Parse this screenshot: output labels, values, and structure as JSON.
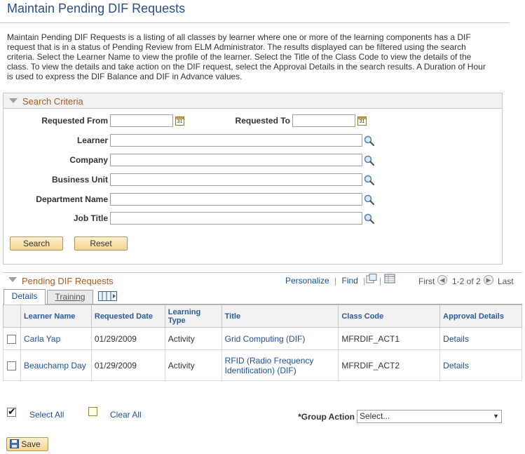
{
  "page": {
    "title": "Maintain Pending DIF Requests",
    "description": "Maintain Pending DIF Requests is a listing of all classes by learner where one or more of the learning components has a DIF request that is in a status of Pending Review from ELM Administrator.  The results displayed can be filtered using the search criteria.  Select the Learner Name to view the profile of the learner.  Select the Title of the Class Code to view the details of the class.  To view the details and take action on the DIF request, select the Approval Details in the search results. A Duration of Hour is used to express the DIF Balance and DIF in Advance values."
  },
  "search": {
    "header": "Search Criteria",
    "requested_from_label": "Requested From",
    "requested_to_label": "Requested To",
    "learner_label": "Learner",
    "company_label": "Company",
    "business_unit_label": "Business Unit",
    "department_label": "Department Name",
    "job_title_label": "Job Title",
    "calendar_text": "31",
    "search_button": "Search",
    "reset_button": "Reset"
  },
  "grid": {
    "header": "Pending DIF Requests",
    "personalize": "Personalize",
    "find": "Find",
    "separator": "|",
    "first": "First",
    "range": "1-2 of 2",
    "last": "Last",
    "tabs": [
      "Details",
      "Training"
    ],
    "columns": [
      "Learner Name",
      "Requested Date",
      "Learning Type",
      "Title",
      "Class Code",
      "Approval Details"
    ],
    "rows": [
      {
        "learner": "Carla Yap",
        "date": "01/29/2009",
        "type": "Activity",
        "title": "Grid Computing (DIF)",
        "code": "MFRDIF_ACT1",
        "details": "Details"
      },
      {
        "learner": "Beauchamp Day",
        "date": "01/29/2009",
        "type": "Activity",
        "title": "RFID (Radio Frequency Identification) (DIF)",
        "code": "MFRDIF_ACT2",
        "details": "Details"
      }
    ]
  },
  "actions": {
    "select_all": "Select All",
    "clear_all": "Clear All",
    "group_action_label": "*Group Action",
    "group_action_value": "Select...",
    "save": "Save"
  },
  "colors": {
    "title": "#2b4f84",
    "section_header": "#b0571d",
    "link": "#1c4fa0",
    "button": "#f3d48e"
  }
}
